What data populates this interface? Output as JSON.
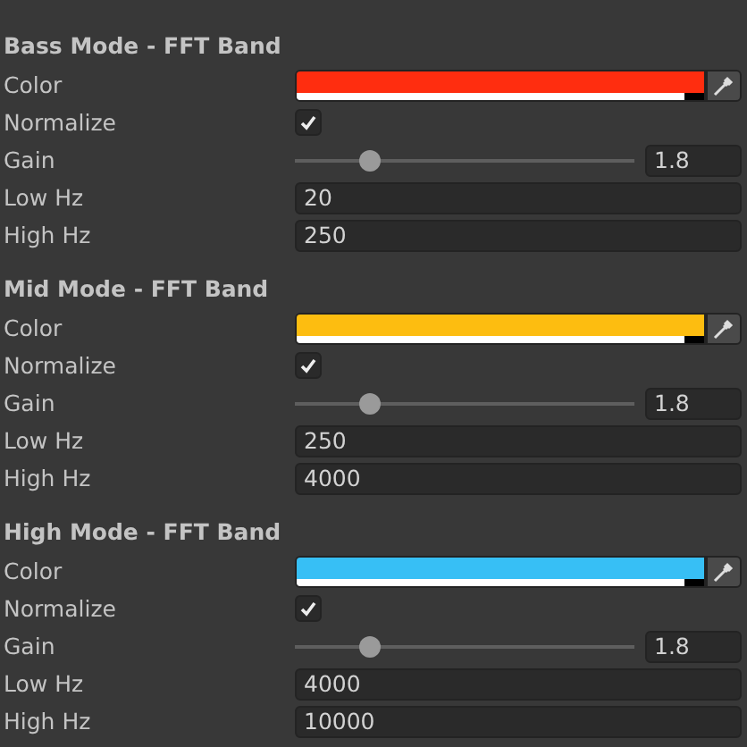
{
  "sections": [
    {
      "title": "Bass Mode - FFT Band",
      "rows": [
        {
          "kind": "color",
          "label": "Color",
          "color": "#ff2d0f"
        },
        {
          "kind": "checkbox",
          "label": "Normalize",
          "checked": true
        },
        {
          "kind": "slider",
          "label": "Gain",
          "level": 0.22,
          "value": "1.8"
        },
        {
          "kind": "number",
          "label": "Low Hz",
          "value": "20"
        },
        {
          "kind": "number",
          "label": "High Hz",
          "value": "250"
        }
      ]
    },
    {
      "title": "Mid Mode - FFT Band",
      "rows": [
        {
          "kind": "color",
          "label": "Color",
          "color": "#fdbd10"
        },
        {
          "kind": "checkbox",
          "label": "Normalize",
          "checked": true
        },
        {
          "kind": "slider",
          "label": "Gain",
          "level": 0.22,
          "value": "1.8"
        },
        {
          "kind": "number",
          "label": "Low Hz",
          "value": "250"
        },
        {
          "kind": "number",
          "label": "High Hz",
          "value": "4000"
        }
      ]
    },
    {
      "title": "High Mode - FFT Band",
      "rows": [
        {
          "kind": "color",
          "label": "Color",
          "color": "#37bff5"
        },
        {
          "kind": "checkbox",
          "label": "Normalize",
          "checked": true
        },
        {
          "kind": "slider",
          "label": "Gain",
          "level": 0.22,
          "value": "1.8"
        },
        {
          "kind": "number",
          "label": "Low Hz",
          "value": "4000"
        },
        {
          "kind": "number",
          "label": "High Hz",
          "value": "10000"
        }
      ]
    }
  ]
}
